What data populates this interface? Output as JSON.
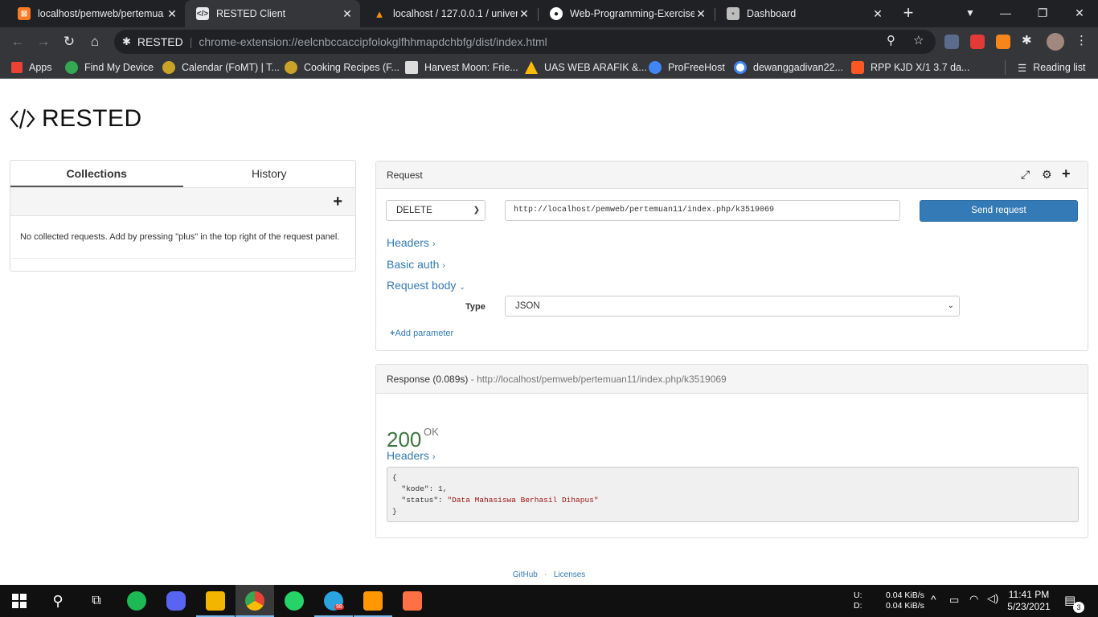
{
  "browser": {
    "tabs": [
      {
        "title": "localhost/pemweb/pertemua",
        "favicon_color": "#fb7a24"
      },
      {
        "title": "RESTED Client",
        "favicon_color": "#5f6368"
      },
      {
        "title": "localhost / 127.0.0.1 / univers",
        "favicon_color": "#f29111"
      },
      {
        "title": "Web-Programming-Exercise/",
        "favicon_color": "#ffffff"
      },
      {
        "title": "Dashboard",
        "favicon_color": "#bdbdbd"
      }
    ],
    "address": {
      "site_label": "RESTED",
      "url": "chrome-extension://eelcnbccaccipfolokglfhhmapdchbfg/dist/index.html"
    },
    "bookmarks": [
      {
        "label": "Apps",
        "color": "#ea4335"
      },
      {
        "label": "Find My Device",
        "color": "#34a853"
      },
      {
        "label": "Calendar (FoMT) | T...",
        "color": "#c9a227"
      },
      {
        "label": "Cooking Recipes (F...",
        "color": "#c9a227"
      },
      {
        "label": "Harvest Moon: Frie...",
        "color": "#dddddd"
      },
      {
        "label": "UAS WEB ARAFIK &...",
        "color": "#fbbc04"
      },
      {
        "label": "ProFreeHost",
        "color": "#4285f4"
      },
      {
        "label": "dewanggadivan22...",
        "color": "#4285f4"
      },
      {
        "label": "RPP KJD X/1 3.7 da...",
        "color": "#ff5722"
      }
    ],
    "reading_list": "Reading list"
  },
  "app": {
    "name": "RESTED",
    "collections": {
      "tab_collections": "Collections",
      "tab_history": "History",
      "add_symbol": "+",
      "empty_text": "No collected requests. Add by pressing \"plus\" in the top right of the request panel."
    },
    "request": {
      "title": "Request",
      "method": "DELETE",
      "url": "http://localhost/pemweb/pertemuan11/index.php/k3519069",
      "send_label": "Send request",
      "headers_label": "Headers",
      "basic_auth_label": "Basic auth",
      "body_label": "Request body",
      "type_label": "Type",
      "type_value": "JSON",
      "add_parameter": "Add parameter"
    },
    "response": {
      "title": "Response (0.089s)",
      "separator": " - ",
      "url": "http://localhost/pemweb/pertemuan11/index.php/k3519069",
      "status_code": "200",
      "status_text": "OK",
      "headers_label": "Headers",
      "body": {
        "open": "{",
        "line1_key": "\"kode\"",
        "line1_val": "1",
        "line2_key": "\"status\"",
        "line2_val": "\"Data Mahasiswa Berhasil Dihapus\"",
        "close": "}"
      }
    },
    "footer": {
      "github": "GitHub",
      "dot": "·",
      "licenses": "Licenses"
    }
  },
  "taskbar": {
    "upload_label": "U:",
    "download_label": "D:",
    "upload_rate": "0.04 KiB/s",
    "download_rate": "0.04 KiB/s",
    "time": "11:41 PM",
    "date": "5/23/2021",
    "notification_count": "3",
    "telegram_badge": "98"
  }
}
